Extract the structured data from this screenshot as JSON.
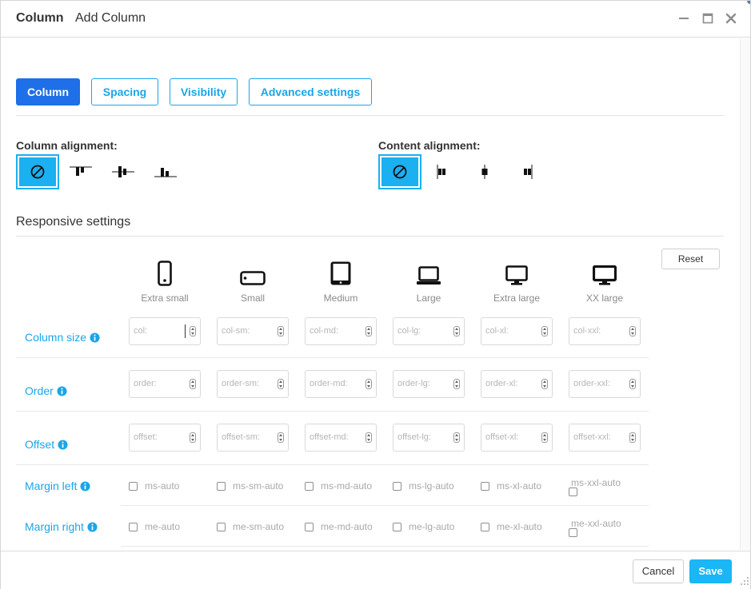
{
  "window": {
    "title": "Column",
    "subtitle": "Add Column"
  },
  "tabs": [
    {
      "label": "Column",
      "active": true
    },
    {
      "label": "Spacing",
      "active": false
    },
    {
      "label": "Visibility",
      "active": false
    },
    {
      "label": "Advanced settings",
      "active": false
    }
  ],
  "column_alignment": {
    "label": "Column alignment:",
    "options": [
      "none-icon",
      "align-top-icon",
      "align-center-icon",
      "align-bottom-icon"
    ],
    "selected": 0
  },
  "content_alignment": {
    "label": "Content alignment:",
    "options": [
      "none-icon",
      "align-start-icon",
      "align-middle-icon",
      "align-end-icon"
    ],
    "selected": 0
  },
  "responsive": {
    "title": "Responsive settings",
    "reset_label": "Reset",
    "breakpoints": [
      {
        "label": "Extra small",
        "icon": "phone-icon"
      },
      {
        "label": "Small",
        "icon": "phone-landscape-icon"
      },
      {
        "label": "Medium",
        "icon": "tablet-icon"
      },
      {
        "label": "Large",
        "icon": "laptop-icon"
      },
      {
        "label": "Extra large",
        "icon": "desktop-icon"
      },
      {
        "label": "XX large",
        "icon": "large-desktop-icon"
      }
    ],
    "rows": {
      "column_size": {
        "label": "Column size",
        "placeholders": [
          "col:",
          "col-sm:",
          "col-md:",
          "col-lg:",
          "col-xl:",
          "col-xxl:"
        ]
      },
      "order": {
        "label": "Order",
        "placeholders": [
          "order:",
          "order-sm:",
          "order-md:",
          "order-lg:",
          "order-xl:",
          "order-xxl:"
        ]
      },
      "offset": {
        "label": "Offset",
        "placeholders": [
          "offset:",
          "offset-sm:",
          "offset-md:",
          "offset-lg:",
          "offset-xl:",
          "offset-xxl:"
        ]
      },
      "margin_left": {
        "label": "Margin left",
        "options": [
          "ms-auto",
          "ms-sm-auto",
          "ms-md-auto",
          "ms-lg-auto",
          "ms-xl-auto",
          "ms-xxl-auto"
        ]
      },
      "margin_right": {
        "label": "Margin right",
        "options": [
          "me-auto",
          "me-sm-auto",
          "me-md-auto",
          "me-lg-auto",
          "me-xl-auto",
          "me-xxl-auto"
        ]
      }
    }
  },
  "footer": {
    "cancel_label": "Cancel",
    "save_label": "Save"
  },
  "colors": {
    "accent": "#1aa6e8",
    "active_tab": "#1e6fe8",
    "save": "#1ab6f5"
  }
}
